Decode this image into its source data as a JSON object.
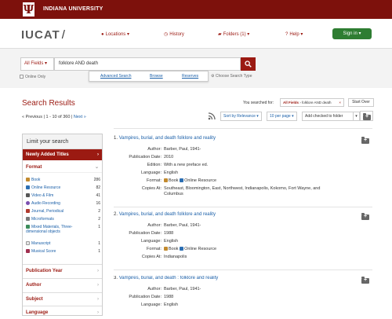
{
  "topbar": {
    "logo_letter": "Ψ",
    "name": "INDIANA UNIVERSITY"
  },
  "navbar": {
    "brand": "IUCAT",
    "brand_slash": "/",
    "links": {
      "locations": "Locations ▾",
      "history": "History",
      "folders": "Folders (1) ▾",
      "help": "Help ▾"
    },
    "signin": "Sign in ▾"
  },
  "search": {
    "field": "All Fields ▾",
    "query": "folklore AND death",
    "online_only": "Online Only",
    "dropdown": {
      "advanced": "Advanced Search",
      "browse": "Browse",
      "reserves": "Reserves"
    },
    "choose_type": "Choose Search Type"
  },
  "results_header": {
    "title": "Search Results",
    "you_searched_for": "You searched for:",
    "chip_field": "All Fields",
    "chip_value": "folklore AND death",
    "chip_close": "×",
    "start_over": "Start Over",
    "prev": "« Previous",
    "range": "1 - 10 of 360",
    "next": "Next »",
    "sort": "Sort by Relevance ▾",
    "per_page": "10 per page ▾",
    "add_checked": "Add checked to folder",
    "add_checked_caret": "▾"
  },
  "sidebar": {
    "heading": "Limit your search",
    "newly_added": "Newly Added Titles",
    "format_heading": "Format",
    "format_items": [
      {
        "label": "Book",
        "count": "286"
      },
      {
        "label": "Online Resource",
        "count": "82"
      },
      {
        "label": "Video & Film",
        "count": "41"
      },
      {
        "label": "Audio Recording",
        "count": "16"
      },
      {
        "label": "Journal, Periodical",
        "count": "2"
      },
      {
        "label": "Microformats",
        "count": "2"
      },
      {
        "label": "Mixed Materials, Three-dimensional objects",
        "count": "1"
      },
      {
        "label": "Manuscript",
        "count": "1"
      },
      {
        "label": "Musical Score",
        "count": "1"
      }
    ],
    "sections": [
      "Publication Year",
      "Author",
      "Subject",
      "Language"
    ],
    "chev_right": "›",
    "chev_down": "⌄"
  },
  "results": [
    {
      "num": "1.",
      "title": "Vampires, burial, and death folklore and reality",
      "author": "Barber, Paul, 1941-",
      "pub_date": "2010",
      "edition": "With a new preface ed.",
      "language": "English",
      "format_a": "Book",
      "format_b": "Online Resource",
      "copies_at": "Southeast, Bloomington, East, Northwest, Indianapolis, Kokomo, Fort Wayne, and Columbus"
    },
    {
      "num": "2.",
      "title": "Vampires, burial, and death folklore and reality",
      "author": "Barber, Paul, 1941-",
      "pub_date": "1988",
      "language": "English",
      "format_a": "Book",
      "format_b": "Online Resource",
      "copies_at": "Indianapolis"
    },
    {
      "num": "3.",
      "title": "Vampires, burial, and death : folklore and reality",
      "author": "Barber, Paul, 1941-",
      "pub_date": "1988",
      "language": "English"
    }
  ],
  "labels": {
    "author": "Author:",
    "pub_date": "Publication Date:",
    "edition": "Edition:",
    "language": "Language:",
    "format": "Format:",
    "copies_at": "Copies At:"
  },
  "colors": {
    "brand_crimson": "#7d110c",
    "link_blue": "#1a5fa8",
    "signin_green": "#2e7d32"
  }
}
